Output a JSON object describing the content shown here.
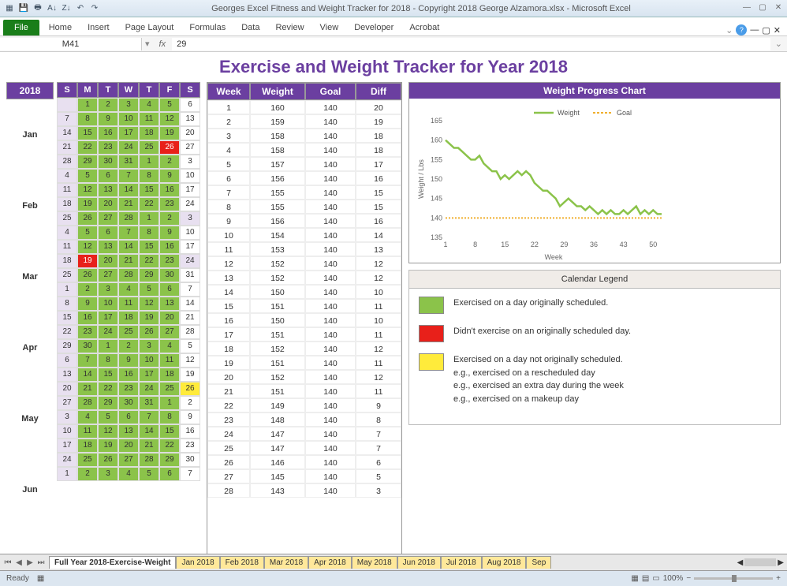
{
  "window_title": "Georges Excel Fitness and Weight Tracker for 2018 - Copyright 2018 George Alzamora.xlsx  -  Microsoft Excel",
  "ribbon": {
    "file": "File",
    "tabs": [
      "Home",
      "Insert",
      "Page Layout",
      "Formulas",
      "Data",
      "Review",
      "View",
      "Developer",
      "Acrobat"
    ]
  },
  "name_box": "M41",
  "formula": "29",
  "title": "Exercise and Weight Tracker for Year 2018",
  "year": "2018",
  "days": [
    "S",
    "M",
    "T",
    "W",
    "T",
    "F",
    "S"
  ],
  "months": [
    "Jan",
    "Feb",
    "Mar",
    "Apr",
    "May",
    "Jun"
  ],
  "calendar": [
    [
      [
        "",
        "lg"
      ],
      [
        "1",
        "g"
      ],
      [
        "2",
        "g"
      ],
      [
        "3",
        "g"
      ],
      [
        "4",
        "g"
      ],
      [
        "5",
        "g"
      ],
      [
        "6",
        ""
      ]
    ],
    [
      [
        "7",
        "lg"
      ],
      [
        "8",
        "g"
      ],
      [
        "9",
        "g"
      ],
      [
        "10",
        "g"
      ],
      [
        "11",
        "g"
      ],
      [
        "12",
        "g"
      ],
      [
        "13",
        ""
      ]
    ],
    [
      [
        "14",
        "lg"
      ],
      [
        "15",
        "g"
      ],
      [
        "16",
        "g"
      ],
      [
        "17",
        "g"
      ],
      [
        "18",
        "g"
      ],
      [
        "19",
        "g"
      ],
      [
        "20",
        ""
      ]
    ],
    [
      [
        "21",
        "lg"
      ],
      [
        "22",
        "g"
      ],
      [
        "23",
        "g"
      ],
      [
        "24",
        "g"
      ],
      [
        "25",
        "g"
      ],
      [
        "26",
        "r"
      ],
      [
        "27",
        ""
      ]
    ],
    [
      [
        "28",
        "lg"
      ],
      [
        "29",
        "g"
      ],
      [
        "30",
        "g"
      ],
      [
        "31",
        "g"
      ],
      [
        "1",
        "g"
      ],
      [
        "2",
        "g"
      ],
      [
        "3",
        ""
      ]
    ],
    [
      [
        "4",
        "lg"
      ],
      [
        "5",
        "g"
      ],
      [
        "6",
        "g"
      ],
      [
        "7",
        "g"
      ],
      [
        "8",
        "g"
      ],
      [
        "9",
        "g"
      ],
      [
        "10",
        ""
      ]
    ],
    [
      [
        "11",
        "lg"
      ],
      [
        "12",
        "g"
      ],
      [
        "13",
        "g"
      ],
      [
        "14",
        "g"
      ],
      [
        "15",
        "g"
      ],
      [
        "16",
        "g"
      ],
      [
        "17",
        ""
      ]
    ],
    [
      [
        "18",
        "lg"
      ],
      [
        "19",
        "g"
      ],
      [
        "20",
        "g"
      ],
      [
        "21",
        "g"
      ],
      [
        "22",
        "g"
      ],
      [
        "23",
        "g"
      ],
      [
        "24",
        ""
      ]
    ],
    [
      [
        "25",
        "lg"
      ],
      [
        "26",
        "g"
      ],
      [
        "27",
        "g"
      ],
      [
        "28",
        "g"
      ],
      [
        "1",
        "g"
      ],
      [
        "2",
        "g"
      ],
      [
        "3",
        "lg"
      ]
    ],
    [
      [
        "4",
        "lg"
      ],
      [
        "5",
        "g"
      ],
      [
        "6",
        "g"
      ],
      [
        "7",
        "g"
      ],
      [
        "8",
        "g"
      ],
      [
        "9",
        "g"
      ],
      [
        "10",
        ""
      ]
    ],
    [
      [
        "11",
        "lg"
      ],
      [
        "12",
        "g"
      ],
      [
        "13",
        "g"
      ],
      [
        "14",
        "g"
      ],
      [
        "15",
        "g"
      ],
      [
        "16",
        "g"
      ],
      [
        "17",
        ""
      ]
    ],
    [
      [
        "18",
        "lg"
      ],
      [
        "19",
        "r"
      ],
      [
        "20",
        "g"
      ],
      [
        "21",
        "g"
      ],
      [
        "22",
        "g"
      ],
      [
        "23",
        "g"
      ],
      [
        "24",
        "lg"
      ]
    ],
    [
      [
        "25",
        "lg"
      ],
      [
        "26",
        "g"
      ],
      [
        "27",
        "g"
      ],
      [
        "28",
        "g"
      ],
      [
        "29",
        "g"
      ],
      [
        "30",
        "g"
      ],
      [
        "31",
        ""
      ]
    ],
    [
      [
        "1",
        "lg"
      ],
      [
        "2",
        "g"
      ],
      [
        "3",
        "g"
      ],
      [
        "4",
        "g"
      ],
      [
        "5",
        "g"
      ],
      [
        "6",
        "g"
      ],
      [
        "7",
        ""
      ]
    ],
    [
      [
        "8",
        "lg"
      ],
      [
        "9",
        "g"
      ],
      [
        "10",
        "g"
      ],
      [
        "11",
        "g"
      ],
      [
        "12",
        "g"
      ],
      [
        "13",
        "g"
      ],
      [
        "14",
        ""
      ]
    ],
    [
      [
        "15",
        "lg"
      ],
      [
        "16",
        "g"
      ],
      [
        "17",
        "g"
      ],
      [
        "18",
        "g"
      ],
      [
        "19",
        "g"
      ],
      [
        "20",
        "g"
      ],
      [
        "21",
        ""
      ]
    ],
    [
      [
        "22",
        "lg"
      ],
      [
        "23",
        "g"
      ],
      [
        "24",
        "g"
      ],
      [
        "25",
        "g"
      ],
      [
        "26",
        "g"
      ],
      [
        "27",
        "g"
      ],
      [
        "28",
        ""
      ]
    ],
    [
      [
        "29",
        "lg"
      ],
      [
        "30",
        "g"
      ],
      [
        "1",
        "g"
      ],
      [
        "2",
        "g"
      ],
      [
        "3",
        "g"
      ],
      [
        "4",
        "g"
      ],
      [
        "5",
        ""
      ]
    ],
    [
      [
        "6",
        "lg"
      ],
      [
        "7",
        "g"
      ],
      [
        "8",
        "g"
      ],
      [
        "9",
        "g"
      ],
      [
        "10",
        "g"
      ],
      [
        "11",
        "g"
      ],
      [
        "12",
        ""
      ]
    ],
    [
      [
        "13",
        "lg"
      ],
      [
        "14",
        "g"
      ],
      [
        "15",
        "g"
      ],
      [
        "16",
        "g"
      ],
      [
        "17",
        "g"
      ],
      [
        "18",
        "g"
      ],
      [
        "19",
        ""
      ]
    ],
    [
      [
        "20",
        "lg"
      ],
      [
        "21",
        "g"
      ],
      [
        "22",
        "g"
      ],
      [
        "23",
        "g"
      ],
      [
        "24",
        "g"
      ],
      [
        "25",
        "g"
      ],
      [
        "26",
        "y"
      ]
    ],
    [
      [
        "27",
        "lg"
      ],
      [
        "28",
        "g"
      ],
      [
        "29",
        "g"
      ],
      [
        "30",
        "g"
      ],
      [
        "31",
        "g"
      ],
      [
        "1",
        "g"
      ],
      [
        "2",
        ""
      ]
    ],
    [
      [
        "3",
        "lg"
      ],
      [
        "4",
        "g"
      ],
      [
        "5",
        "g"
      ],
      [
        "6",
        "g"
      ],
      [
        "7",
        "g"
      ],
      [
        "8",
        "g"
      ],
      [
        "9",
        ""
      ]
    ],
    [
      [
        "10",
        "lg"
      ],
      [
        "11",
        "g"
      ],
      [
        "12",
        "g"
      ],
      [
        "13",
        "g"
      ],
      [
        "14",
        "g"
      ],
      [
        "15",
        "g"
      ],
      [
        "16",
        ""
      ]
    ],
    [
      [
        "17",
        "lg"
      ],
      [
        "18",
        "g"
      ],
      [
        "19",
        "g"
      ],
      [
        "20",
        "g"
      ],
      [
        "21",
        "g"
      ],
      [
        "22",
        "g"
      ],
      [
        "23",
        ""
      ]
    ],
    [
      [
        "24",
        "lg"
      ],
      [
        "25",
        "g"
      ],
      [
        "26",
        "g"
      ],
      [
        "27",
        "g"
      ],
      [
        "28",
        "g"
      ],
      [
        "29",
        "g"
      ],
      [
        "30",
        ""
      ]
    ],
    [
      [
        "1",
        "lg"
      ],
      [
        "2",
        "g"
      ],
      [
        "3",
        "g"
      ],
      [
        "4",
        "g"
      ],
      [
        "5",
        "g"
      ],
      [
        "6",
        "g"
      ],
      [
        "7",
        ""
      ]
    ]
  ],
  "week_headers": [
    "Week",
    "Weight",
    "Goal",
    "Diff"
  ],
  "weeks": [
    [
      1,
      160,
      140,
      20
    ],
    [
      2,
      159,
      140,
      19
    ],
    [
      3,
      158,
      140,
      18
    ],
    [
      4,
      158,
      140,
      18
    ],
    [
      5,
      157,
      140,
      17
    ],
    [
      6,
      156,
      140,
      16
    ],
    [
      7,
      155,
      140,
      15
    ],
    [
      8,
      155,
      140,
      15
    ],
    [
      9,
      156,
      140,
      16
    ],
    [
      10,
      154,
      140,
      14
    ],
    [
      11,
      153,
      140,
      13
    ],
    [
      12,
      152,
      140,
      12
    ],
    [
      13,
      152,
      140,
      12
    ],
    [
      14,
      150,
      140,
      10
    ],
    [
      15,
      151,
      140,
      11
    ],
    [
      16,
      150,
      140,
      10
    ],
    [
      17,
      151,
      140,
      11
    ],
    [
      18,
      152,
      140,
      12
    ],
    [
      19,
      151,
      140,
      11
    ],
    [
      20,
      152,
      140,
      12
    ],
    [
      21,
      151,
      140,
      11
    ],
    [
      22,
      149,
      140,
      9
    ],
    [
      23,
      148,
      140,
      8
    ],
    [
      24,
      147,
      140,
      7
    ],
    [
      25,
      147,
      140,
      7
    ],
    [
      26,
      146,
      140,
      6
    ],
    [
      27,
      145,
      140,
      5
    ],
    [
      28,
      143,
      140,
      3
    ]
  ],
  "chart_title": "Weight Progress Chart",
  "chart_data": {
    "type": "line",
    "title": "Weight Progress Chart",
    "xlabel": "Week",
    "ylabel": "Weight / Lbs",
    "x": [
      1,
      8,
      15,
      22,
      29,
      36,
      43,
      50
    ],
    "ylim": [
      135,
      165
    ],
    "series": [
      {
        "name": "Weight",
        "color": "#8bc34a",
        "values": [
          160,
          159,
          158,
          158,
          157,
          156,
          155,
          155,
          156,
          154,
          153,
          152,
          152,
          150,
          151,
          150,
          151,
          152,
          151,
          152,
          151,
          149,
          148,
          147,
          147,
          146,
          145,
          143,
          144,
          145,
          144,
          143,
          143,
          142,
          143,
          142,
          141,
          142,
          141,
          142,
          141,
          141,
          142,
          141,
          142,
          143,
          141,
          142,
          141,
          142,
          141,
          141
        ]
      },
      {
        "name": "Goal",
        "color": "#f0b030",
        "style": "dashed",
        "values": [
          140,
          140,
          140,
          140,
          140,
          140,
          140,
          140,
          140,
          140,
          140,
          140,
          140,
          140,
          140,
          140,
          140,
          140,
          140,
          140,
          140,
          140,
          140,
          140,
          140,
          140,
          140,
          140,
          140,
          140,
          140,
          140,
          140,
          140,
          140,
          140,
          140,
          140,
          140,
          140,
          140,
          140,
          140,
          140,
          140,
          140,
          140,
          140,
          140,
          140,
          140,
          140
        ]
      }
    ]
  },
  "legend_title": "Calendar Legend",
  "legend": [
    {
      "color": "#8bc34a",
      "text": "Exercised on a day originally scheduled."
    },
    {
      "color": "#e8201a",
      "text": "Didn't exercise on an originally scheduled day."
    },
    {
      "color": "#ffeb3b",
      "text": "Exercised on a day not originally scheduled.\ne.g., exercised on a rescheduled day\ne.g., exercised an extra day during the week\ne.g., exercised on a makeup day"
    }
  ],
  "sheet_tabs": [
    "Full Year 2018-Exercise-Weight",
    "Jan 2018",
    "Feb 2018",
    "Mar 2018",
    "Apr 2018",
    "May 2018",
    "Jun 2018",
    "Jul 2018",
    "Aug 2018",
    "Sep"
  ],
  "status": "Ready",
  "zoom": "100%"
}
